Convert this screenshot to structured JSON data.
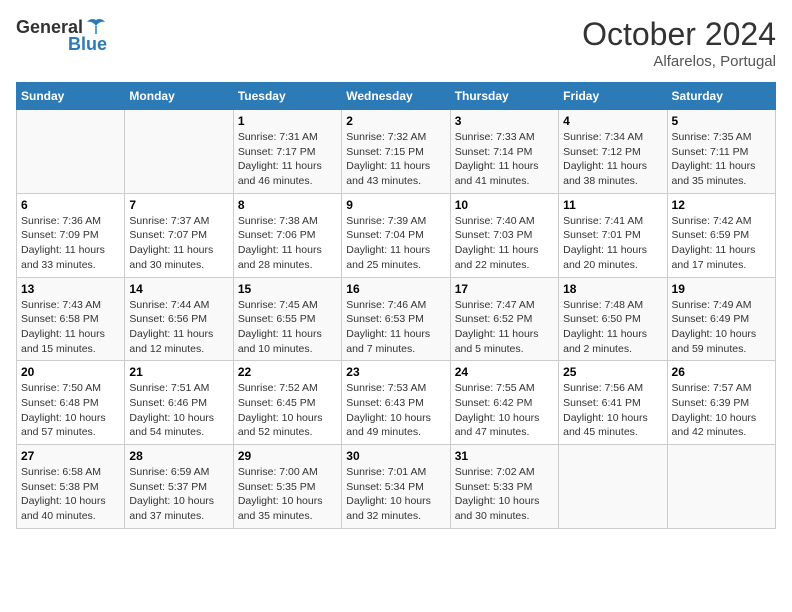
{
  "header": {
    "logo": {
      "text_general": "General",
      "text_blue": "Blue"
    },
    "month": "October 2024",
    "location": "Alfarelos, Portugal"
  },
  "columns": [
    "Sunday",
    "Monday",
    "Tuesday",
    "Wednesday",
    "Thursday",
    "Friday",
    "Saturday"
  ],
  "weeks": [
    [
      {
        "day": "",
        "sunrise": "",
        "sunset": "",
        "daylight": ""
      },
      {
        "day": "",
        "sunrise": "",
        "sunset": "",
        "daylight": ""
      },
      {
        "day": "1",
        "sunrise": "Sunrise: 7:31 AM",
        "sunset": "Sunset: 7:17 PM",
        "daylight": "Daylight: 11 hours and 46 minutes."
      },
      {
        "day": "2",
        "sunrise": "Sunrise: 7:32 AM",
        "sunset": "Sunset: 7:15 PM",
        "daylight": "Daylight: 11 hours and 43 minutes."
      },
      {
        "day": "3",
        "sunrise": "Sunrise: 7:33 AM",
        "sunset": "Sunset: 7:14 PM",
        "daylight": "Daylight: 11 hours and 41 minutes."
      },
      {
        "day": "4",
        "sunrise": "Sunrise: 7:34 AM",
        "sunset": "Sunset: 7:12 PM",
        "daylight": "Daylight: 11 hours and 38 minutes."
      },
      {
        "day": "5",
        "sunrise": "Sunrise: 7:35 AM",
        "sunset": "Sunset: 7:11 PM",
        "daylight": "Daylight: 11 hours and 35 minutes."
      }
    ],
    [
      {
        "day": "6",
        "sunrise": "Sunrise: 7:36 AM",
        "sunset": "Sunset: 7:09 PM",
        "daylight": "Daylight: 11 hours and 33 minutes."
      },
      {
        "day": "7",
        "sunrise": "Sunrise: 7:37 AM",
        "sunset": "Sunset: 7:07 PM",
        "daylight": "Daylight: 11 hours and 30 minutes."
      },
      {
        "day": "8",
        "sunrise": "Sunrise: 7:38 AM",
        "sunset": "Sunset: 7:06 PM",
        "daylight": "Daylight: 11 hours and 28 minutes."
      },
      {
        "day": "9",
        "sunrise": "Sunrise: 7:39 AM",
        "sunset": "Sunset: 7:04 PM",
        "daylight": "Daylight: 11 hours and 25 minutes."
      },
      {
        "day": "10",
        "sunrise": "Sunrise: 7:40 AM",
        "sunset": "Sunset: 7:03 PM",
        "daylight": "Daylight: 11 hours and 22 minutes."
      },
      {
        "day": "11",
        "sunrise": "Sunrise: 7:41 AM",
        "sunset": "Sunset: 7:01 PM",
        "daylight": "Daylight: 11 hours and 20 minutes."
      },
      {
        "day": "12",
        "sunrise": "Sunrise: 7:42 AM",
        "sunset": "Sunset: 6:59 PM",
        "daylight": "Daylight: 11 hours and 17 minutes."
      }
    ],
    [
      {
        "day": "13",
        "sunrise": "Sunrise: 7:43 AM",
        "sunset": "Sunset: 6:58 PM",
        "daylight": "Daylight: 11 hours and 15 minutes."
      },
      {
        "day": "14",
        "sunrise": "Sunrise: 7:44 AM",
        "sunset": "Sunset: 6:56 PM",
        "daylight": "Daylight: 11 hours and 12 minutes."
      },
      {
        "day": "15",
        "sunrise": "Sunrise: 7:45 AM",
        "sunset": "Sunset: 6:55 PM",
        "daylight": "Daylight: 11 hours and 10 minutes."
      },
      {
        "day": "16",
        "sunrise": "Sunrise: 7:46 AM",
        "sunset": "Sunset: 6:53 PM",
        "daylight": "Daylight: 11 hours and 7 minutes."
      },
      {
        "day": "17",
        "sunrise": "Sunrise: 7:47 AM",
        "sunset": "Sunset: 6:52 PM",
        "daylight": "Daylight: 11 hours and 5 minutes."
      },
      {
        "day": "18",
        "sunrise": "Sunrise: 7:48 AM",
        "sunset": "Sunset: 6:50 PM",
        "daylight": "Daylight: 11 hours and 2 minutes."
      },
      {
        "day": "19",
        "sunrise": "Sunrise: 7:49 AM",
        "sunset": "Sunset: 6:49 PM",
        "daylight": "Daylight: 10 hours and 59 minutes."
      }
    ],
    [
      {
        "day": "20",
        "sunrise": "Sunrise: 7:50 AM",
        "sunset": "Sunset: 6:48 PM",
        "daylight": "Daylight: 10 hours and 57 minutes."
      },
      {
        "day": "21",
        "sunrise": "Sunrise: 7:51 AM",
        "sunset": "Sunset: 6:46 PM",
        "daylight": "Daylight: 10 hours and 54 minutes."
      },
      {
        "day": "22",
        "sunrise": "Sunrise: 7:52 AM",
        "sunset": "Sunset: 6:45 PM",
        "daylight": "Daylight: 10 hours and 52 minutes."
      },
      {
        "day": "23",
        "sunrise": "Sunrise: 7:53 AM",
        "sunset": "Sunset: 6:43 PM",
        "daylight": "Daylight: 10 hours and 49 minutes."
      },
      {
        "day": "24",
        "sunrise": "Sunrise: 7:55 AM",
        "sunset": "Sunset: 6:42 PM",
        "daylight": "Daylight: 10 hours and 47 minutes."
      },
      {
        "day": "25",
        "sunrise": "Sunrise: 7:56 AM",
        "sunset": "Sunset: 6:41 PM",
        "daylight": "Daylight: 10 hours and 45 minutes."
      },
      {
        "day": "26",
        "sunrise": "Sunrise: 7:57 AM",
        "sunset": "Sunset: 6:39 PM",
        "daylight": "Daylight: 10 hours and 42 minutes."
      }
    ],
    [
      {
        "day": "27",
        "sunrise": "Sunrise: 6:58 AM",
        "sunset": "Sunset: 5:38 PM",
        "daylight": "Daylight: 10 hours and 40 minutes."
      },
      {
        "day": "28",
        "sunrise": "Sunrise: 6:59 AM",
        "sunset": "Sunset: 5:37 PM",
        "daylight": "Daylight: 10 hours and 37 minutes."
      },
      {
        "day": "29",
        "sunrise": "Sunrise: 7:00 AM",
        "sunset": "Sunset: 5:35 PM",
        "daylight": "Daylight: 10 hours and 35 minutes."
      },
      {
        "day": "30",
        "sunrise": "Sunrise: 7:01 AM",
        "sunset": "Sunset: 5:34 PM",
        "daylight": "Daylight: 10 hours and 32 minutes."
      },
      {
        "day": "31",
        "sunrise": "Sunrise: 7:02 AM",
        "sunset": "Sunset: 5:33 PM",
        "daylight": "Daylight: 10 hours and 30 minutes."
      },
      {
        "day": "",
        "sunrise": "",
        "sunset": "",
        "daylight": ""
      },
      {
        "day": "",
        "sunrise": "",
        "sunset": "",
        "daylight": ""
      }
    ]
  ]
}
